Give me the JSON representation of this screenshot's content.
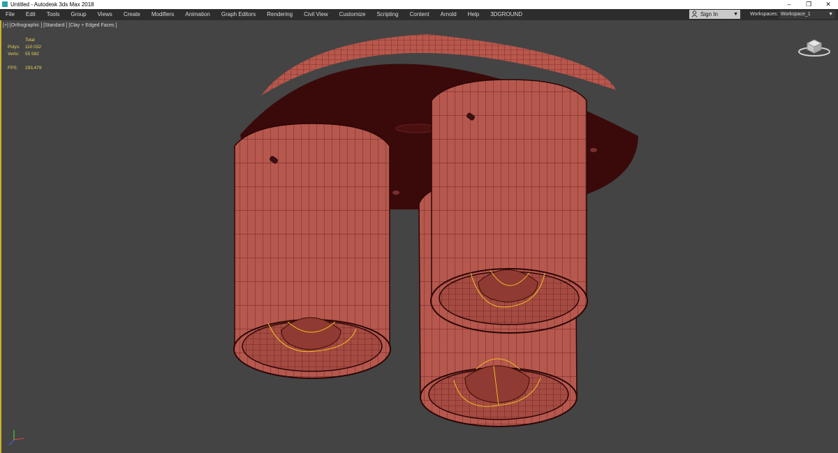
{
  "window": {
    "title": "Untitled - Autodesk 3ds Max 2018",
    "controls": [
      "–",
      "❐",
      "✕"
    ]
  },
  "menu": {
    "items": [
      "File",
      "Edit",
      "Tools",
      "Group",
      "Views",
      "Create",
      "Modifiers",
      "Animation",
      "Graph Editors",
      "Rendering",
      "Civil View",
      "Customize",
      "Scripting",
      "Content",
      "Arnold",
      "Help",
      "3DGROUND"
    ]
  },
  "signin": {
    "label": "Sign In",
    "icon": "user-icon"
  },
  "workspace": {
    "label": "Workspaces:",
    "value": "Workspace_1"
  },
  "viewport": {
    "label": "[+] [Orthographic ] [Standard ] [Clay + Edged Faces ]",
    "stats": {
      "header": "Total",
      "polys_label": "Polys:",
      "polys": "110 032",
      "verts_label": "Verts:",
      "verts": "55 582",
      "fps_label": "FPS:",
      "fps": "293,479"
    }
  },
  "colors": {
    "mesh": "#b6584e",
    "mesh_dark": "#3a0a0a",
    "wire": "#5a1212",
    "light_gizmo": "#f0c020",
    "viewport_bg": "#444444",
    "active_border": "#c9b22c",
    "stats_text": "#e5d25b"
  }
}
